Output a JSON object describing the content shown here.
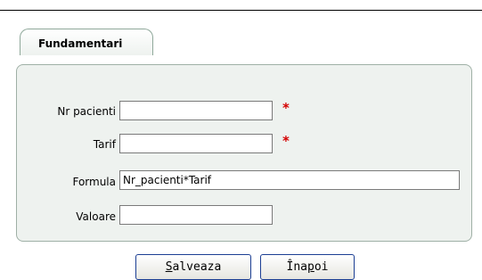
{
  "tab": {
    "label": "Fundamentari"
  },
  "form": {
    "nr_pacienti": {
      "label": "Nr pacienti",
      "value": "",
      "required": "*"
    },
    "tarif": {
      "label": "Tarif",
      "value": "",
      "required": "*"
    },
    "formula": {
      "label": "Formula",
      "value": "Nr_pacienti*Tarif"
    },
    "valoare": {
      "label": "Valoare",
      "value": ""
    }
  },
  "buttons": {
    "save": {
      "accel": "S",
      "rest": "alveaza"
    },
    "back": {
      "pre": "Îna",
      "accel": "p",
      "rest": "oi"
    }
  }
}
